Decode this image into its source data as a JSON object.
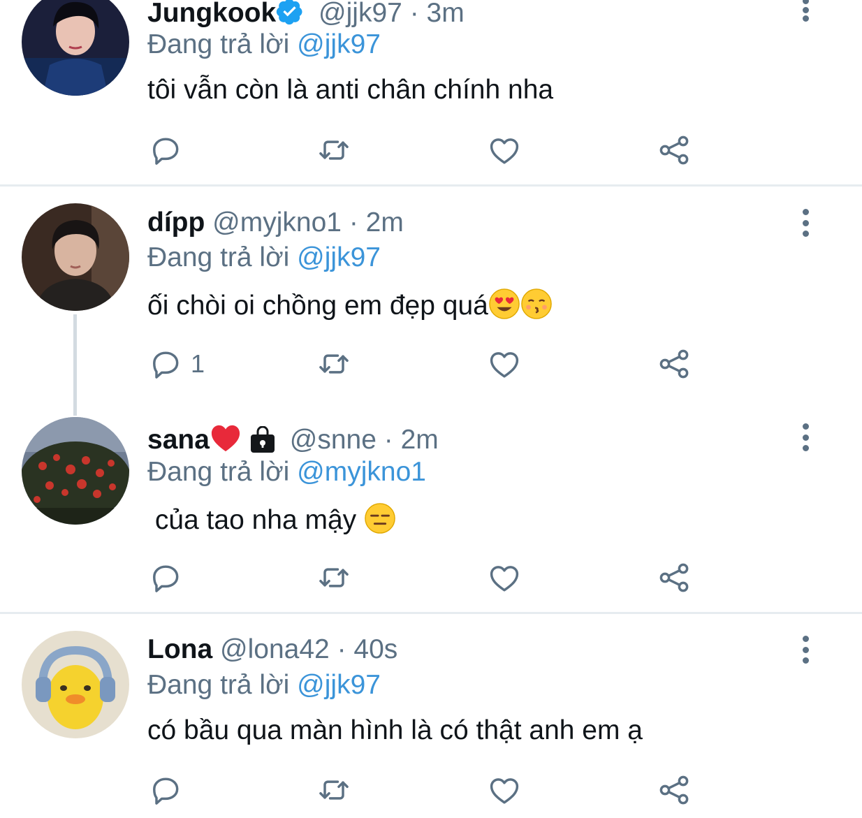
{
  "tweets": [
    {
      "name": "Jungkook",
      "verified": true,
      "handle": "@jjk97",
      "separator": "·",
      "time": "3m",
      "replying_prefix": "Đang trả lời",
      "replying_to": "@jjk97",
      "text": "tôi vẫn còn là anti chân chính nha",
      "reply_count": "",
      "avatar_icon": "dark-portrait-avatar"
    },
    {
      "name": "dípp",
      "verified": false,
      "handle": "@myjkno1",
      "separator": "·",
      "time": "2m",
      "replying_prefix": "Đang trả lời",
      "replying_to": "@jjk97",
      "text": "ối chòi oi chồng em đẹp quá",
      "text_emojis": [
        "heart-eyes-emoji",
        "kissing-emoji"
      ],
      "reply_count": "1",
      "avatar_icon": "portrait-avatar"
    },
    {
      "name": "sana",
      "verified": false,
      "name_emojis": [
        "red-heart-emoji",
        "locked-bag-emoji"
      ],
      "handle": "@snne",
      "separator": "·",
      "time": "2m",
      "replying_prefix": "Đang trả lời",
      "replying_to": "@myjkno1",
      "text": " của tao nha mậy",
      "text_emojis": [
        "expressionless-emoji"
      ],
      "reply_count": "",
      "avatar_icon": "flower-tree-avatar"
    },
    {
      "name": "Lona",
      "verified": false,
      "handle": "@lona42",
      "separator": "·",
      "time": "40s",
      "replying_prefix": "Đang trả lời",
      "replying_to": "@jjk97",
      "text": "có bầu qua màn hình là có thật anh em ạ",
      "reply_count": "",
      "avatar_icon": "duck-headphones-avatar"
    }
  ],
  "action_icons": [
    "reply-icon",
    "retweet-icon",
    "like-icon",
    "share-icon"
  ],
  "colors": {
    "text": "#0f1419",
    "secondary": "#5b7083",
    "mention": "#3b94d9",
    "verified": "#1da1f2",
    "divider": "#e6ecf0"
  }
}
